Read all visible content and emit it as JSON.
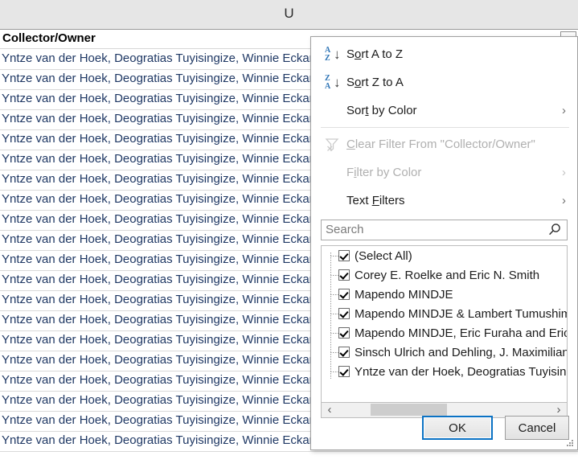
{
  "sheet": {
    "column_letter": "U",
    "filter_header": {
      "label": "Collector/Owner",
      "dropdown_icon": "chevron-down-icon"
    },
    "cell_text": "Yntze van der Hoek, Deogratias Tuyisingize, Winnie Eckardt, Nuria Garriga, Mia Al Bernic",
    "row_count": 20,
    "text_color": "#1f3864",
    "header_band_color": "#e6e6e6"
  },
  "autofilter": {
    "menu": [
      {
        "label_pre": "S",
        "label_key": "o",
        "label_post": "rt A to Z",
        "icon": "sort-a-to-z-icon",
        "icon_top": "A",
        "icon_bottom": "Z",
        "disabled": false,
        "submenu": false
      },
      {
        "label_pre": "S",
        "label_key": "o",
        "label_post": "rt Z to A",
        "icon": "sort-z-to-a-icon",
        "icon_top": "Z",
        "icon_bottom": "A",
        "disabled": false,
        "submenu": false
      },
      {
        "label_pre": "Sor",
        "label_key": "t",
        "label_post": " by Color",
        "icon": "none",
        "disabled": false,
        "submenu": true
      },
      {
        "label_pre": "",
        "label_key": "C",
        "label_post": "lear Filter From \"Collector/Owner\"",
        "icon": "clear-filter-icon",
        "disabled": true,
        "submenu": false
      },
      {
        "label_pre": "F",
        "label_key": "i",
        "label_post": "lter by Color",
        "icon": "none",
        "disabled": true,
        "submenu": true
      },
      {
        "label_pre": "Text ",
        "label_key": "F",
        "label_post": "ilters",
        "icon": "none",
        "disabled": false,
        "submenu": true
      }
    ],
    "separator_after_index": 2,
    "search": {
      "placeholder": "Search",
      "value": "",
      "icon": "search-icon"
    },
    "list": {
      "items": [
        {
          "label": "(Select All)",
          "checked": true
        },
        {
          "label": "Corey E. Roelke and Eric N. Smith",
          "checked": true
        },
        {
          "label": "Mapendo MINDJE",
          "checked": true
        },
        {
          "label": "Mapendo MINDJE & Lambert Tumushimire",
          "checked": true
        },
        {
          "label": "Mapendo MINDJE, Eric Furaha and Eric Gashirabake",
          "checked": true
        },
        {
          "label": "Sinsch Ulrich and Dehling, J. Maximilian",
          "checked": true
        },
        {
          "label": "Yntze van der Hoek, Deogratias Tuyisingize",
          "checked": true
        }
      ]
    },
    "hscroll": {
      "left_arrow": "‹",
      "right_arrow": "›"
    },
    "buttons": {
      "ok": "OK",
      "cancel": "Cancel",
      "focus_color": "#0b72c4"
    },
    "submenu_arrow": "›"
  }
}
